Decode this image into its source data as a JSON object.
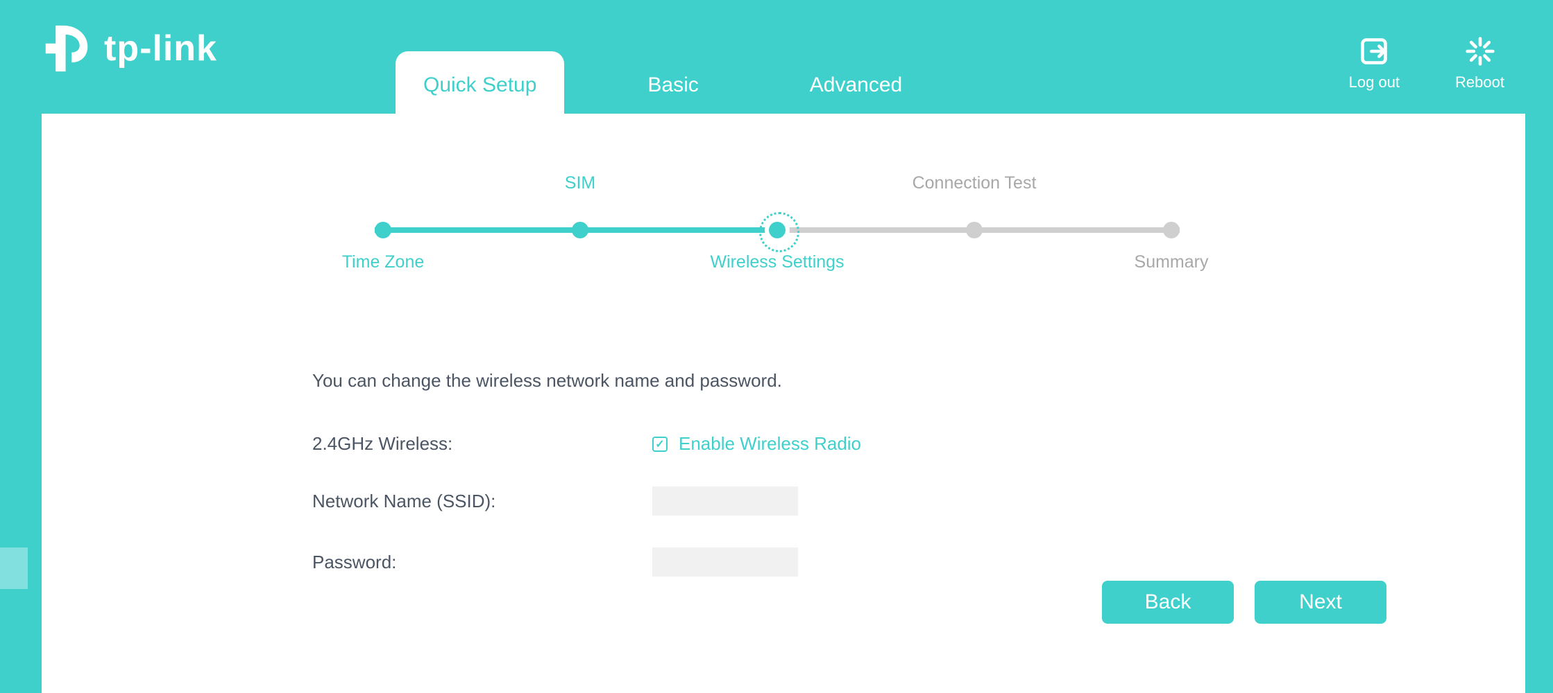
{
  "brand": {
    "name": "tp-link"
  },
  "tabs": {
    "quick_setup": "Quick Setup",
    "basic": "Basic",
    "advanced": "Advanced"
  },
  "header_actions": {
    "logout": "Log out",
    "reboot": "Reboot"
  },
  "stepper": {
    "time_zone": "Time Zone",
    "sim": "SIM",
    "wireless_settings": "Wireless Settings",
    "connection_test": "Connection Test",
    "summary": "Summary"
  },
  "form": {
    "intro": "You can change the wireless network name and password.",
    "wireless_24_label": "2.4GHz Wireless:",
    "enable_wireless_label": "Enable Wireless Radio",
    "enable_wireless_checked": true,
    "ssid_label": "Network Name (SSID):",
    "ssid_value": "",
    "password_label": "Password:",
    "password_value": ""
  },
  "buttons": {
    "back": "Back",
    "next": "Next"
  },
  "colors": {
    "accent": "#40D0CC"
  }
}
